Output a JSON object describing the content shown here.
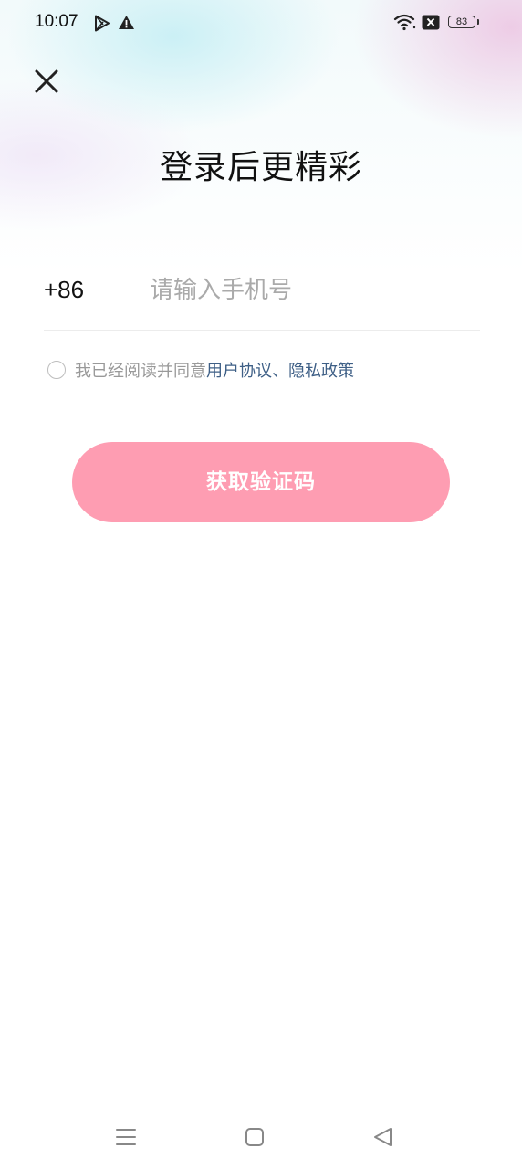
{
  "status_bar": {
    "time": "10:07",
    "battery_level": "83",
    "icons": [
      "play-store-icon",
      "alert-icon",
      "wifi-icon",
      "sim-off-icon",
      "battery-icon"
    ]
  },
  "header": {
    "close_icon": "close-icon",
    "title": "登录后更精彩"
  },
  "login_form": {
    "country_code": "+86",
    "phone_placeholder": "请输入手机号",
    "phone_value": "",
    "agreement_prefix": "我已经阅读并同意",
    "user_agreement": "用户协议",
    "separator": "、",
    "privacy_policy": "隐私政策",
    "agreement_checked": false,
    "submit_label": "获取验证码"
  },
  "colors": {
    "accent_button": "#fe9db2",
    "link": "#3e5f86",
    "placeholder": "#aaaaaa"
  },
  "nav_bar": {
    "icons": [
      "menu-icon",
      "home-icon",
      "back-icon"
    ]
  }
}
